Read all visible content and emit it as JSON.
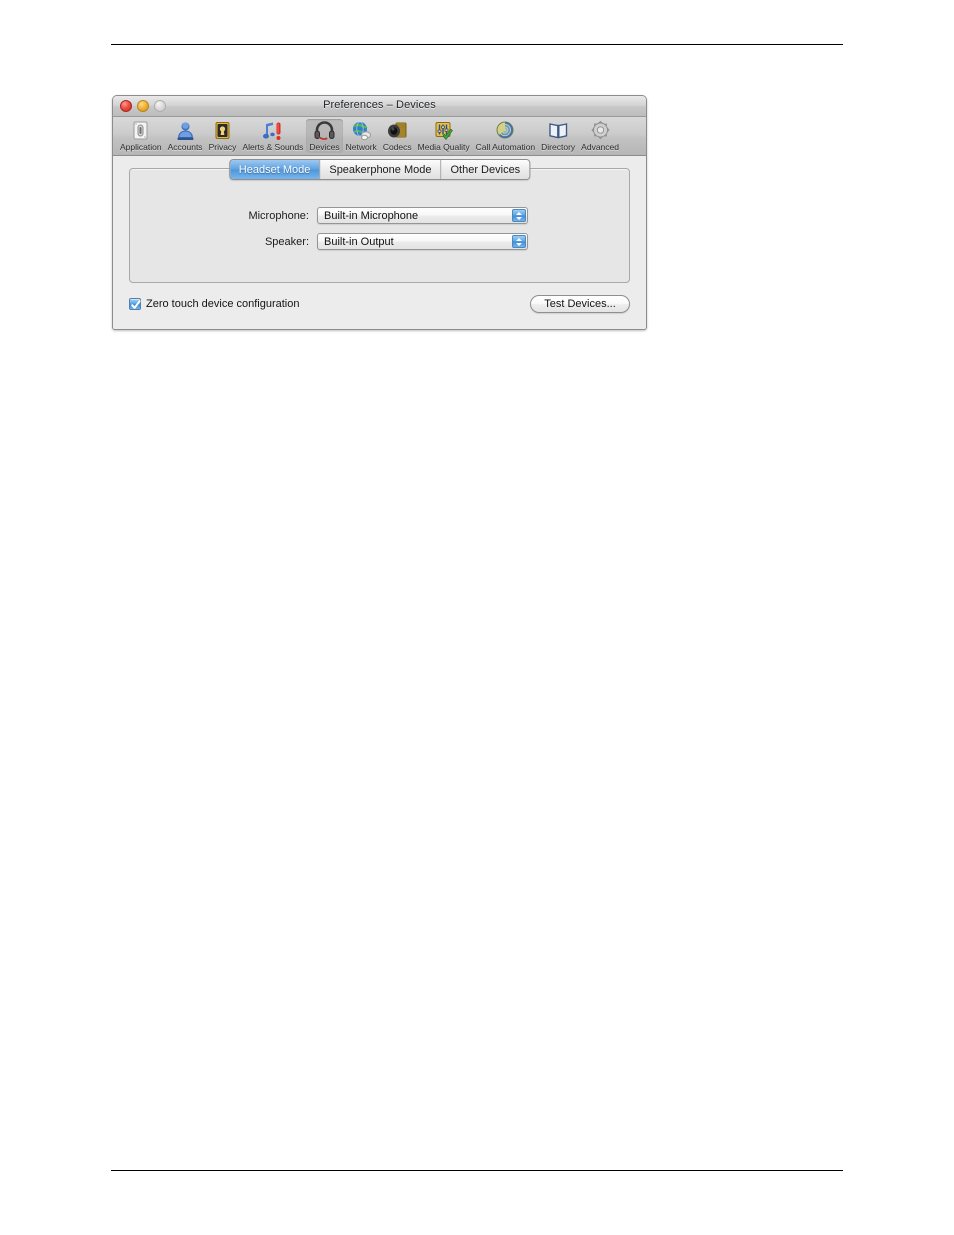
{
  "window": {
    "title": "Preferences – Devices",
    "traffic_lights": [
      {
        "name": "close",
        "color": "#ee4f43"
      },
      {
        "name": "minimize",
        "color": "#f4b43c"
      },
      {
        "name": "zoom",
        "color": "#dddddd"
      }
    ]
  },
  "toolbar": {
    "items": [
      {
        "label": "Application",
        "icon": "light-switch-icon",
        "selected": false
      },
      {
        "label": "Accounts",
        "icon": "person-icon",
        "selected": false
      },
      {
        "label": "Privacy",
        "icon": "keyhole-icon",
        "selected": false
      },
      {
        "label": "Alerts & Sounds",
        "icon": "note-exclamation-icon",
        "selected": false
      },
      {
        "label": "Devices",
        "icon": "headset-icon",
        "selected": true
      },
      {
        "label": "Network",
        "icon": "globe-icon",
        "selected": false
      },
      {
        "label": "Codecs",
        "icon": "speaker-chip-icon",
        "selected": false
      },
      {
        "label": "Media Quality",
        "icon": "sliders-check-icon",
        "selected": false
      },
      {
        "label": "Call Automation",
        "icon": "swirl-icon",
        "selected": false
      },
      {
        "label": "Directory",
        "icon": "book-icon",
        "selected": false
      },
      {
        "label": "Advanced",
        "icon": "gear-icon",
        "selected": false
      }
    ]
  },
  "tabs": [
    {
      "label": "Headset Mode",
      "active": true
    },
    {
      "label": "Speakerphone Mode",
      "active": false
    },
    {
      "label": "Other Devices",
      "active": false
    }
  ],
  "form": {
    "microphone": {
      "label": "Microphone:",
      "value": "Built-in Microphone"
    },
    "speaker": {
      "label": "Speaker:",
      "value": "Built-in Output"
    }
  },
  "bottom": {
    "zero_touch_label": "Zero touch device configuration",
    "zero_touch_checked": true,
    "test_devices_label": "Test Devices..."
  },
  "colors": {
    "accent_blue": "#4b96dd",
    "window_bg": "#ececec",
    "toolbar_bg": "#c2c2c2"
  }
}
